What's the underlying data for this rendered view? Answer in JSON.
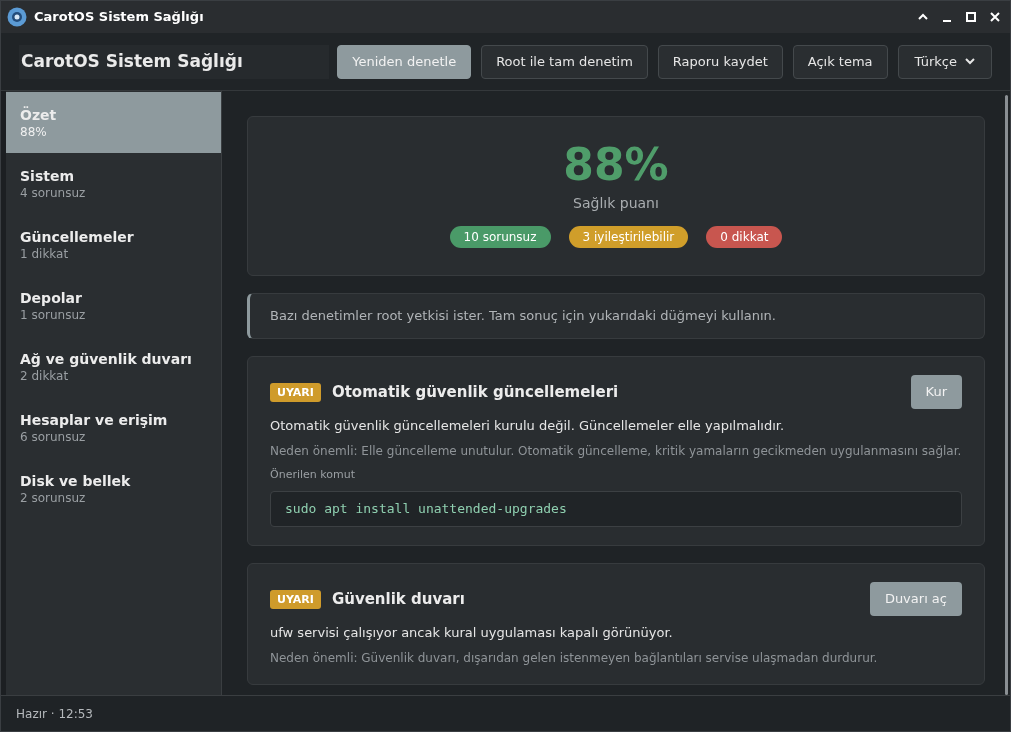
{
  "window": {
    "title": "CarotOS Sistem Sağlığı"
  },
  "header": {
    "title": "CarotOS Sistem Sağlığı"
  },
  "toolbar": {
    "buttons": [
      {
        "label": "Yeniden denetle",
        "selected": true
      },
      {
        "label": "Root ile tam denetim",
        "selected": false
      },
      {
        "label": "Raporu kaydet",
        "selected": false
      },
      {
        "label": "Açık tema",
        "selected": false
      }
    ],
    "language": {
      "value": "Türkçe"
    }
  },
  "sidebar": {
    "items": [
      {
        "title": "Özet",
        "subtitle": "88%",
        "selected": true
      },
      {
        "title": "Sistem",
        "subtitle": "4 sorunsuz",
        "selected": false
      },
      {
        "title": "Güncellemeler",
        "subtitle": "1 dikkat",
        "selected": false
      },
      {
        "title": "Depolar",
        "subtitle": "1 sorunsuz",
        "selected": false
      },
      {
        "title": "Ağ ve güvenlik duvarı",
        "subtitle": "2 dikkat",
        "selected": false
      },
      {
        "title": "Hesaplar ve erişim",
        "subtitle": "6 sorunsuz",
        "selected": false
      },
      {
        "title": "Disk ve bellek",
        "subtitle": "2 sorunsuz",
        "selected": false
      }
    ]
  },
  "summary": {
    "score": "88%",
    "score_label": "Sağlık puanı",
    "pills": [
      {
        "label": "10 sorunsuz",
        "color": "#4a9a68"
      },
      {
        "label": "3 iyileştirilebilir",
        "color": "#d09e2a"
      },
      {
        "label": "0 dikkat",
        "color": "#c8564f"
      }
    ]
  },
  "notice": "Bazı denetimler root yetkisi ister. Tam sonuç için yukarıdaki düğmeyi kullanın.",
  "findings": [
    {
      "kind": "warning",
      "tag": "UYARI",
      "title": "Otomatik güvenlik güncellemeleri",
      "action": "Kur",
      "description": "Otomatik güvenlik güncellemeleri kurulu değil. Güncellemeler elle yapılmalıdır.",
      "why": "Neden önemli: Elle güncelleme unutulur. Otomatik güncelleme, kritik yamaların gecikmeden uygulanmasını sağlar.",
      "command_label": "Önerilen komut",
      "command": "sudo apt install unattended-upgrades"
    },
    {
      "kind": "warning",
      "tag": "UYARI",
      "title": "Güvenlik duvarı",
      "action": "Duvarı aç",
      "description": "ufw servisi çalışıyor ancak kural uygulaması kapalı görünüyor.",
      "why": "Neden önemli: Güvenlik duvarı, dışarıdan gelen istenmeyen bağlantıları servise ulaşmadan durdurur."
    }
  ],
  "status_bar": {
    "text": "Hazır · 12:53"
  }
}
